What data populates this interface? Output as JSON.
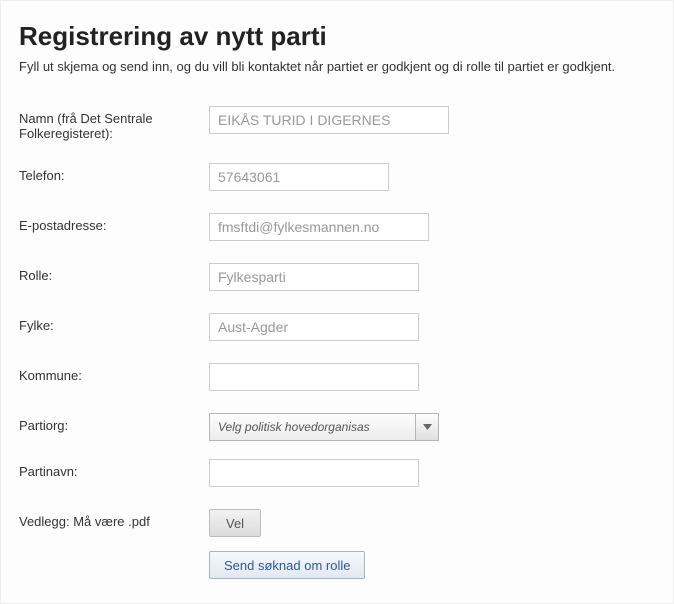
{
  "header": {
    "title": "Registrering av nytt parti",
    "intro": "Fyll ut skjema og send inn, og du vill bli kontaktet når partiet er godkjent og di rolle til partiet er godkjent."
  },
  "form": {
    "name_label": "Namn (frå Det Sentrale Folkeregisteret):",
    "name_value": "EIKÅS TURID I DIGERNES",
    "phone_label": "Telefon:",
    "phone_value": "57643061",
    "email_label": "E-postadresse:",
    "email_value": "fmsftdi@fylkesmannen.no",
    "role_label": "Rolle:",
    "role_value": "Fylkesparti",
    "county_label": "Fylke:",
    "county_value": "Aust-Agder",
    "municipality_label": "Kommune:",
    "municipality_value": "",
    "partyorg_label": "Partiorg:",
    "partyorg_selected": "Velg politisk hovedorganisas",
    "partyname_label": "Partinavn:",
    "partyname_value": "",
    "attachment_label": "Vedlegg: Må være .pdf",
    "attachment_button": "Vel",
    "submit_button": "Send søknad om rolle"
  }
}
